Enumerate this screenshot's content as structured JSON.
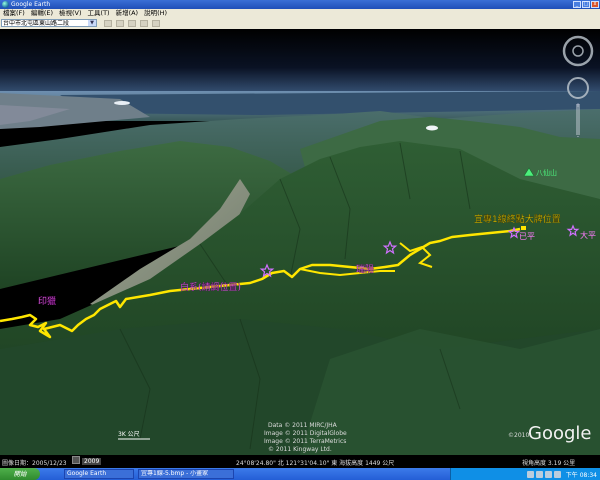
{
  "window": {
    "title": "Google Earth"
  },
  "menu": [
    "檔案(F)",
    "編輯(E)",
    "檢視(V)",
    "工具(T)",
    "新增(A)",
    "說明(H)"
  ],
  "search": {
    "value": "台中市北屯區東山路二段"
  },
  "map_labels": {
    "paiwan": "印獵",
    "baixi": "白系(請調位置)",
    "ruihe": "瑞陽",
    "end_sign": "宜專1線終點大牌位置",
    "peak1": "已平",
    "peak2": "大平",
    "mountain": "八仙山"
  },
  "attribution": {
    "line1": "Data © 2011 MIRC/JHA",
    "line2": "Image © 2011 DigitalGlobe",
    "line3": "Image © 2011 TerraMetrics",
    "line4": "© 2011 Kingway Ltd."
  },
  "copyright_year": "©2010",
  "google_logo": "Google",
  "scale_label": "3K 公尺",
  "status": {
    "imagery_date": "圖像日期：2005/12/23",
    "year": "2009",
    "coords": "24°08'24.80\" 北 121°31'04.10\" 東  海拔高度 1449 公尺",
    "eye_alt": "視角高度 3.19 公里"
  },
  "taskbar": {
    "start": "開始",
    "apps": [
      "Google Earth",
      "宜專1線-5.bmp - 小畫家"
    ],
    "clock": "下午 08:34"
  }
}
